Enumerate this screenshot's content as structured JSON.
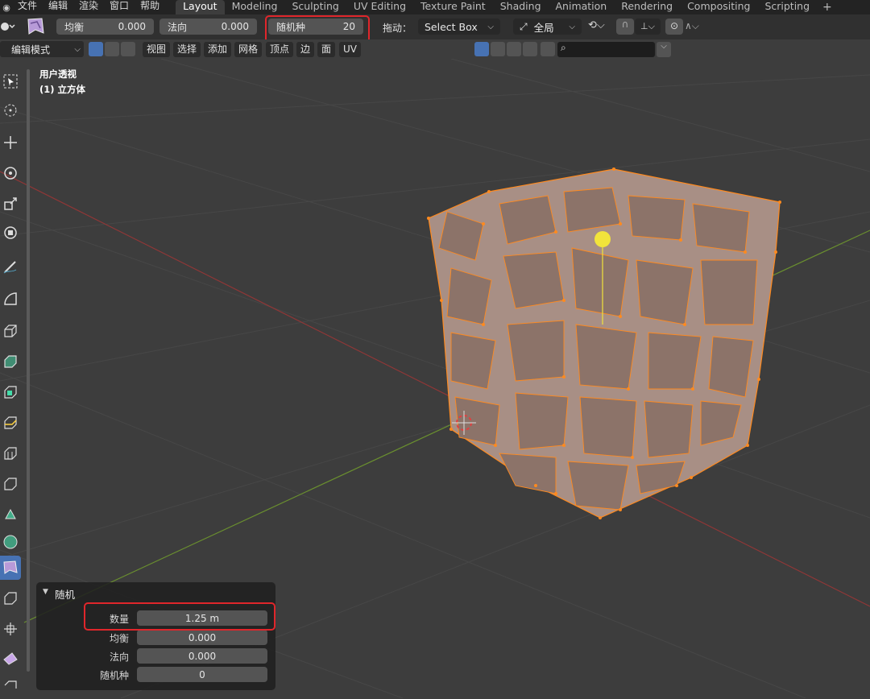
{
  "menu": {
    "items": [
      "文件",
      "编辑",
      "渲染",
      "窗口",
      "帮助"
    ]
  },
  "workspaces": {
    "tabs": [
      "Layout",
      "Modeling",
      "Sculpting",
      "UV Editing",
      "Texture Paint",
      "Shading",
      "Animation",
      "Rendering",
      "Compositing",
      "Scripting"
    ],
    "add": "+"
  },
  "tool_header": {
    "balance": {
      "label": "均衡",
      "value": "0.000"
    },
    "normal": {
      "label": "法向",
      "value": "0.000"
    },
    "seed": {
      "label": "随机种",
      "value": "20"
    },
    "drag_label": "拖动：",
    "drag_value": "Select Box",
    "orientation": "全局"
  },
  "editor_header": {
    "mode": "编辑模式",
    "menus": [
      "视图",
      "选择",
      "添加",
      "网格",
      "顶点",
      "边",
      "面",
      "UV"
    ]
  },
  "viewport": {
    "view_name": "用户透视",
    "object_name": "(1) 立方体"
  },
  "operator_panel": {
    "title": "随机",
    "rows": [
      {
        "label": "数量",
        "value": "1.25 m"
      },
      {
        "label": "均衡",
        "value": "0.000"
      },
      {
        "label": "法向",
        "value": "0.000"
      },
      {
        "label": "随机种",
        "value": "0"
      }
    ]
  },
  "colors": {
    "accent": "#4772b3",
    "highlight": "#e0262b",
    "mesh_face": "#a88f85",
    "mesh_vertex": "#ff8a1f",
    "light": "#f2e43b"
  }
}
